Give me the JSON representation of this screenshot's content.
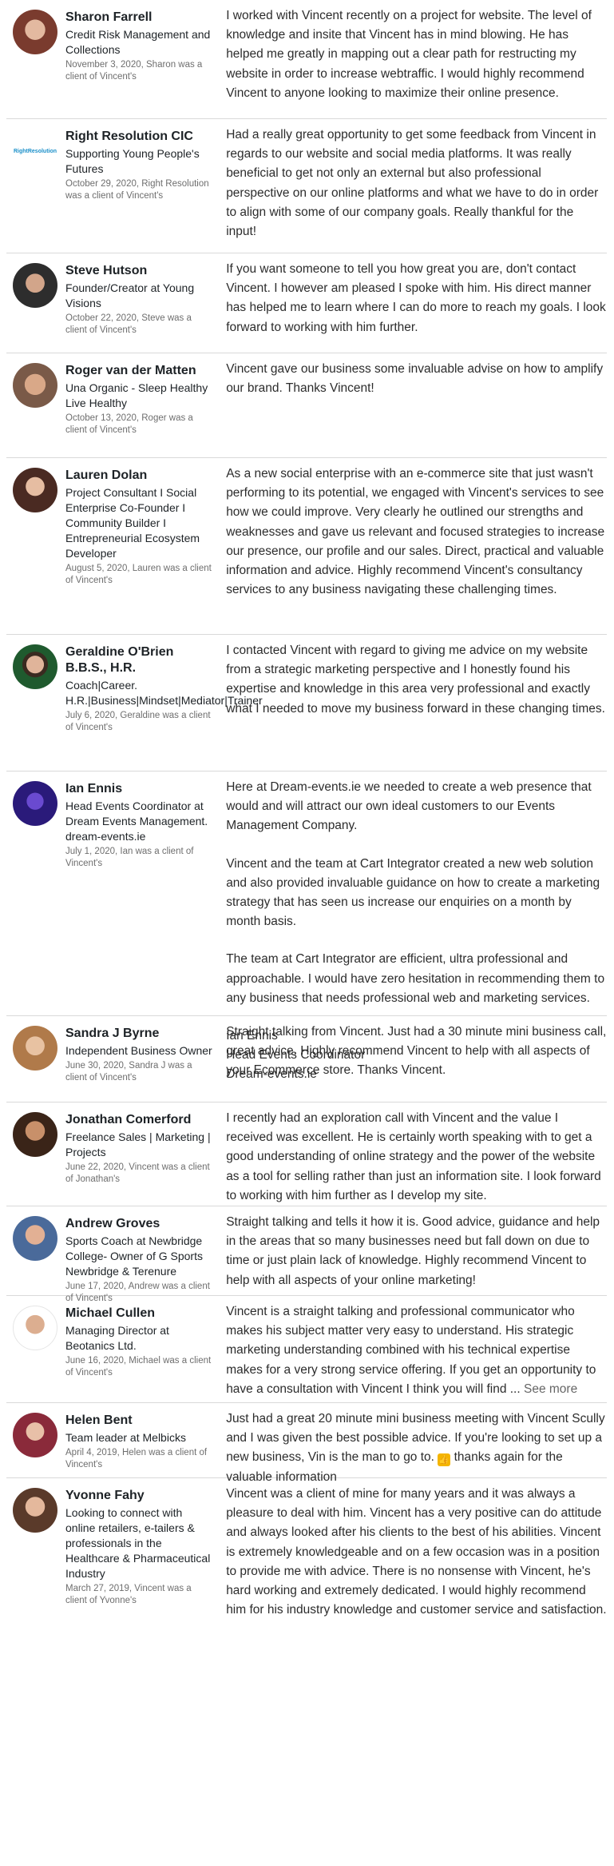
{
  "recommendations": [
    {
      "name": "Sharon Farrell",
      "headline": "Credit Risk Management and Collections",
      "meta": "November 3, 2020, Sharon was a client of Vincent's",
      "text": [
        "I worked with Vincent recently on a project for website. The level of knowledge and insite that Vincent has in mind blowing. He has helped me greatly in mapping out a clear path for restructing my website in order to increase webtraffic. I would highly recommend Vincent to anyone looking to maximize their online presence."
      ],
      "avatar_color": "#7a3b2e"
    },
    {
      "name": "Right Resolution CIC",
      "headline": "Supporting Young People's Futures",
      "meta": "October 29, 2020, Right Resolution was a client of Vincent's",
      "text": [
        "Had a really great opportunity to get some feedback from Vincent in regards to our website and social media platforms. It was really beneficial to get not only an external but also professional perspective on our online platforms and what we have to do in order to align with some of our company goals. Really thankful for the input!"
      ],
      "logo_text": "RightResolution",
      "avatar_color": "#1a8fc9"
    },
    {
      "name": "Steve Hutson",
      "headline": "Founder/Creator at Young Visions",
      "meta": "October 22, 2020, Steve was a client of Vincent's",
      "text": [
        "If you want someone to tell you how great you are, don't contact Vincent. I however am pleased I spoke with him. His direct manner has helped me to learn where I can do more to reach my goals. I look forward to working with him further."
      ],
      "avatar_color": "#3a3a3a"
    },
    {
      "name": "Roger van der Matten",
      "headline": "Una Organic - Sleep Healthy Live Healthy",
      "meta": "October 13, 2020, Roger was a client of Vincent's",
      "text": [
        "Vincent gave our business some invaluable advise on how to amplify our brand. Thanks Vincent!"
      ],
      "avatar_color": "#b98a6a"
    },
    {
      "name": "Lauren Dolan",
      "headline": "Project Consultant I Social Enterprise Co-Founder I Community Builder I Entrepreneurial Ecosystem Developer",
      "meta": "August 5, 2020, Lauren was a client of Vincent's",
      "text": [
        "As a new social enterprise with an e-commerce site that just wasn't performing to its potential, we engaged with Vincent's services to see how we could improve. Very clearly he outlined our strengths and weaknesses and gave us relevant and focused strategies to increase our presence, our profile and our sales. Direct, practical and valuable information and advice. Highly recommend Vincent's consultancy services to any business navigating these challenging times."
      ],
      "avatar_color": "#4a2a22"
    },
    {
      "name": "Geraldine O'Brien B.B.S., H.R.",
      "headline": "Coach|Career. H.R.|Business|Mindset|Mediator|Trainer",
      "meta": "July 6, 2020, Geraldine was a client of Vincent's",
      "text": [
        "I contacted Vincent with regard to giving me advice on my website from a strategic marketing perspective and I honestly found his expertise and knowledge in this area very professional and exactly what I needed to move my business forward in these changing times."
      ],
      "avatar_color": "#1f5a2e"
    },
    {
      "name": "Ian Ennis",
      "headline": "Head Events Coordinator at Dream Events Management. dream-events.ie",
      "meta": "July 1, 2020, Ian was a client of Vincent's",
      "text": [
        "Here at Dream-events.ie we needed to create a web presence that would and will attract our own ideal customers to our Events Management Company.",
        "Vincent and the team at Cart Integrator created a new web solution and also provided invaluable guidance on how to create a marketing strategy that has seen us increase our enquiries on a month by month basis.",
        "The team at Cart Integrator are efficient, ultra professional and approachable. I would have zero hesitation in recommending them to any business that needs professional web and marketing services.",
        "Ian Ennis\nHead Events Coordinator\nDream-events.ie"
      ],
      "avatar_color": "#2a1a7a"
    },
    {
      "name": "Sandra J Byrne",
      "headline": "Independent Business Owner",
      "meta": "June 30, 2020, Sandra J was a client of Vincent's",
      "text": [
        "Straight talking from Vincent. Just had a 30 minute mini business call, great advice. Highly recommend Vincent to help with all aspects of your Ecommerce store. Thanks Vincent."
      ],
      "avatar_color": "#b07a4a"
    },
    {
      "name": "Jonathan Comerford",
      "headline": "Freelance Sales | Marketing | Projects",
      "meta": "June 22, 2020, Vincent was a client of Jonathan's",
      "text": [
        "I recently had an exploration call with Vincent and the value I received was excellent. He is certainly worth speaking with to get a good understanding of online strategy and the power of the website as a tool for selling rather than just an information site. I look forward to working with him further as I develop my site."
      ],
      "avatar_color": "#6a3a2a"
    },
    {
      "name": "Andrew Groves",
      "headline": "Sports Coach at Newbridge College- Owner of G Sports Newbridge & Terenure",
      "meta": "June 17, 2020, Andrew was a client of Vincent's",
      "text": [
        "Straight talking and tells it how it is. Good advice, guidance and help in the areas that so many businesses need but fall down on due to time or just plain lack of knowledge. Highly recommend Vincent to help with all aspects of your online marketing!"
      ],
      "avatar_color": "#4a6a9a"
    },
    {
      "name": "Michael Cullen",
      "headline": "Managing Director at Beotanics Ltd.",
      "meta": "June 16, 2020, Michael was a client of Vincent's",
      "text": [
        "Vincent is a straight talking and professional communicator who makes his subject matter very easy to understand. His strategic marketing understanding combined with his technical expertise makes for a very strong service offering. If you get an opportunity to have a consultation with Vincent I think you will find ..."
      ],
      "see_more": "See more",
      "avatar_color": "#c9a48a"
    },
    {
      "name": "Helen Bent",
      "headline": "Team leader at Melbicks",
      "meta": "April 4, 2019, Helen was a client of Vincent's",
      "text_before": "Just had a great 20 minute mini business meeting with Vincent Scully and I was given the best possible advice. If you're looking to set up a new business, Vin is the man to go to. ",
      "text_after": " thanks again for the valuable information",
      "emoji": "👍",
      "avatar_color": "#8a2a3a"
    },
    {
      "name": "Yvonne Fahy",
      "headline": "Looking to connect with online retailers, e-tailers & professionals in the Healthcare & Pharmaceutical Industry",
      "meta": "March 27, 2019, Vincent was a client of Yvonne's",
      "text": [
        "Vincent was a client of mine for many years and it was always a pleasure to deal with him. Vincent has a very positive can do attitude and always looked after his clients to the best of his abilities. Vincent is extremely knowledgeable and on a few occasion was in a position to provide me with advice. There is no nonsense with Vincent, he's hard working and extremely dedicated. I would highly recommend him for his industry knowledge and customer service and satisfaction."
      ],
      "avatar_color": "#5a3a2a"
    }
  ]
}
